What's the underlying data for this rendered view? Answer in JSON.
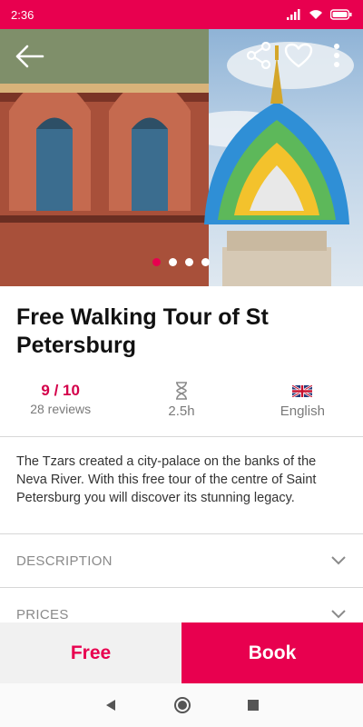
{
  "status_bar": {
    "time": "2:36"
  },
  "hero": {
    "icons": [
      "back-arrow-icon",
      "share-icon",
      "heart-icon",
      "more-vert-icon"
    ],
    "carousel": {
      "total": 4,
      "active_index": 0
    }
  },
  "tour": {
    "title": "Free Walking Tour of St Petersburg",
    "rating": "9 / 10",
    "reviews": "28 reviews",
    "duration": "2.5h",
    "language": "English",
    "description": "The Tzars created a city-palace on the banks of the Neva River. With this free tour of the centre of Saint Petersburg you will discover its stunning legacy."
  },
  "sections": [
    {
      "label": "DESCRIPTION"
    },
    {
      "label": "PRICES"
    }
  ],
  "actions": {
    "free_label": "Free",
    "book_label": "Book"
  },
  "colors": {
    "accent": "#e8004f",
    "rating": "#d4004a",
    "muted": "#7a7a7a"
  }
}
